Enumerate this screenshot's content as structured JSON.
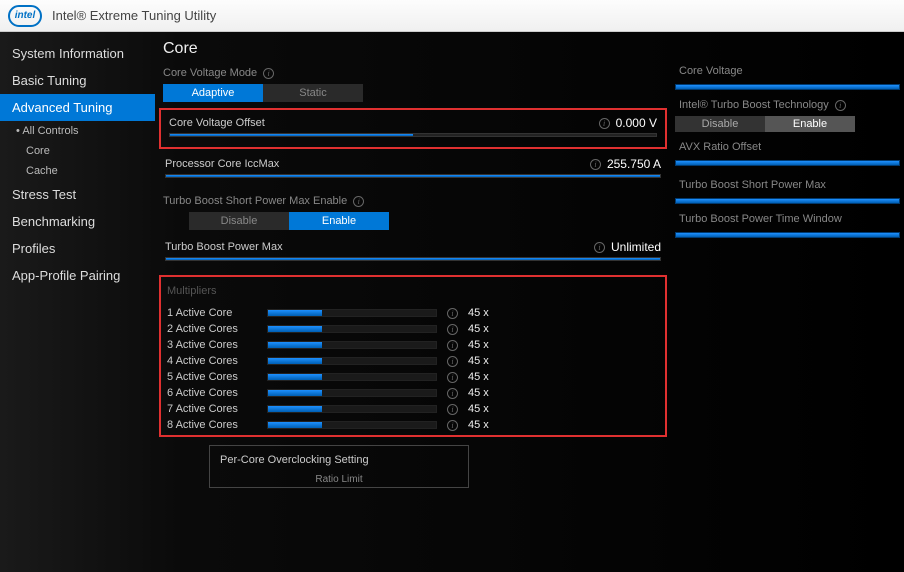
{
  "app": {
    "title": "Intel® Extreme Tuning Utility",
    "logo_text": "intel"
  },
  "sidebar": {
    "items": [
      {
        "label": "System Information"
      },
      {
        "label": "Basic Tuning"
      },
      {
        "label": "Advanced Tuning",
        "active": true
      },
      {
        "label": "Stress Test"
      },
      {
        "label": "Benchmarking"
      },
      {
        "label": "Profiles"
      },
      {
        "label": "App-Profile Pairing"
      }
    ],
    "adv_sub": [
      {
        "label": "All Controls",
        "bullet": true
      },
      {
        "label": "Core"
      },
      {
        "label": "Cache"
      }
    ]
  },
  "page": {
    "title": "Core"
  },
  "core_voltage_mode": {
    "label": "Core Voltage Mode",
    "options": [
      "Adaptive",
      "Static"
    ],
    "selected": 0
  },
  "core_voltage_offset": {
    "label": "Core Voltage Offset",
    "value": "0.000 V",
    "fill_pct": 50
  },
  "iccmax": {
    "label": "Processor Core IccMax",
    "value": "255.750 A",
    "fill_pct": 100
  },
  "tb_short_enable": {
    "label": "Turbo Boost Short Power Max Enable",
    "options": [
      "Disable",
      "Enable"
    ],
    "selected": 1
  },
  "tb_power_max": {
    "label": "Turbo Boost Power Max",
    "value": "Unlimited",
    "fill_pct": 100
  },
  "multipliers": {
    "title": "Multipliers",
    "rows": [
      {
        "label": "1 Active Core",
        "value": "45 x",
        "fill_pct": 32
      },
      {
        "label": "2 Active Cores",
        "value": "45 x",
        "fill_pct": 32
      },
      {
        "label": "3 Active Cores",
        "value": "45 x",
        "fill_pct": 32
      },
      {
        "label": "4 Active Cores",
        "value": "45 x",
        "fill_pct": 32
      },
      {
        "label": "5 Active Cores",
        "value": "45 x",
        "fill_pct": 32
      },
      {
        "label": "6 Active Cores",
        "value": "45 x",
        "fill_pct": 32
      },
      {
        "label": "7 Active Cores",
        "value": "45 x",
        "fill_pct": 32
      },
      {
        "label": "8 Active Cores",
        "value": "45 x",
        "fill_pct": 32
      }
    ]
  },
  "percore": {
    "title": "Per-Core Overclocking Setting",
    "sub": "Ratio Limit"
  },
  "right": {
    "core_voltage": {
      "label": "Core Voltage"
    },
    "turbo_tech": {
      "label": "Intel® Turbo Boost Technology",
      "options": [
        "Disable",
        "Enable"
      ],
      "selected": 1
    },
    "avx": {
      "label": "AVX Ratio Offset"
    },
    "tb_short": {
      "label": "Turbo Boost Short Power Max"
    },
    "tb_time": {
      "label": "Turbo Boost Power Time Window"
    }
  }
}
